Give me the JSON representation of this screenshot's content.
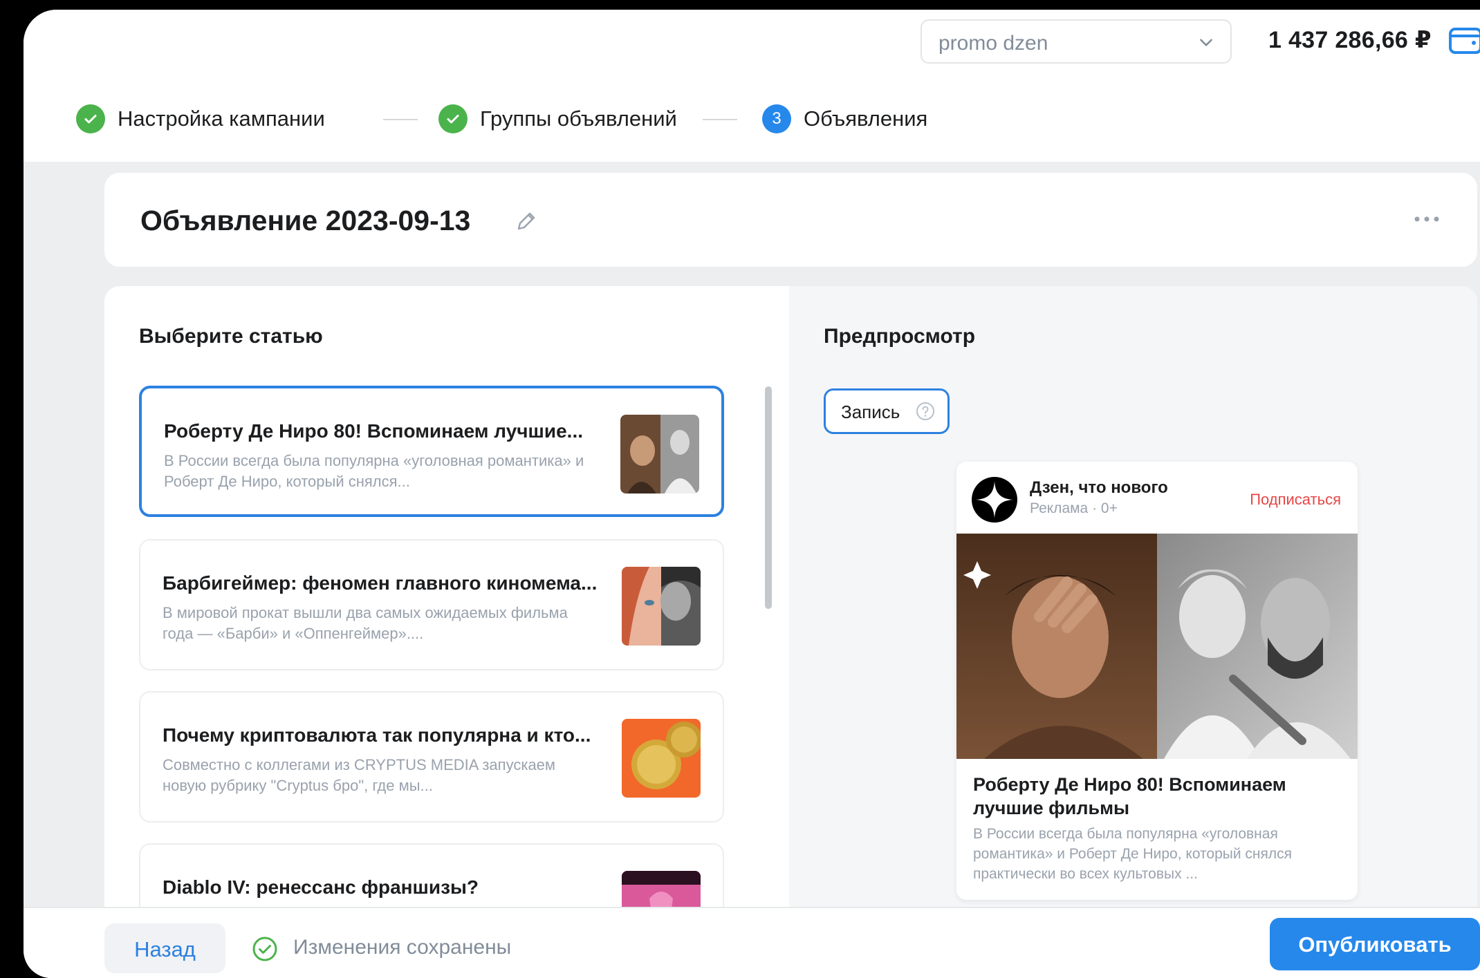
{
  "header": {
    "account_value": "promo dzen",
    "balance": "1 437 286,66 ₽"
  },
  "stepper": {
    "steps": [
      {
        "label": "Настройка кампании",
        "state": "done"
      },
      {
        "label": "Группы объявлений",
        "state": "done"
      },
      {
        "number": "3",
        "label": "Объявления",
        "state": "active"
      }
    ]
  },
  "ad": {
    "title": "Объявление 2023-09-13"
  },
  "articles_section": {
    "heading": "Выберите статью",
    "items": [
      {
        "title": "Роберту Де Ниро 80! Вспоминаем лучшие...",
        "desc": "В России всегда была популярна «уголовная романтика» и Роберт Де Ниро, который снялся...",
        "selected": true
      },
      {
        "title": "Барбигеймер: феномен главного киномема...",
        "desc": "В  мировой прокат вышли два самых ожидаемых фильма года — «Барби» и «Оппенгеймер»....",
        "selected": false
      },
      {
        "title": "Почему криптовалюта так популярна и кто...",
        "desc": "Совместно с коллегами из CRYPTUS MEDIA запускаем новую рубрику \"Cryptus бро\", где мы...",
        "selected": false
      },
      {
        "title": "Diablo IV: ренессанс франшизы?",
        "desc": "",
        "selected": false
      }
    ]
  },
  "preview_section": {
    "heading": "Предпросмотр",
    "format_label": "Запись",
    "card": {
      "channel": "Дзен, что нового",
      "meta": "Реклама · 0+",
      "subscribe": "Подписаться",
      "title": "Роберту Де Ниро 80! Вспоминаем лучшие фильмы",
      "desc": "В России всегда была популярна «уголовная романтика» и Роберт Де Ниро, который снялся практически во всех культовых ..."
    }
  },
  "footer": {
    "back_label": "Назад",
    "saved_text": "Изменения сохранены",
    "publish_label": "Опубликовать"
  },
  "colors": {
    "accent": "#2688eb",
    "success": "#4bb34b",
    "subscribe": "#e64646"
  },
  "icons": [
    "chevron-down-icon",
    "wallet-icon",
    "check-icon",
    "edit-pencil-icon",
    "more-horizontal-icon",
    "help-circle-icon",
    "zen-logo-icon",
    "check-circle-outline-icon"
  ]
}
